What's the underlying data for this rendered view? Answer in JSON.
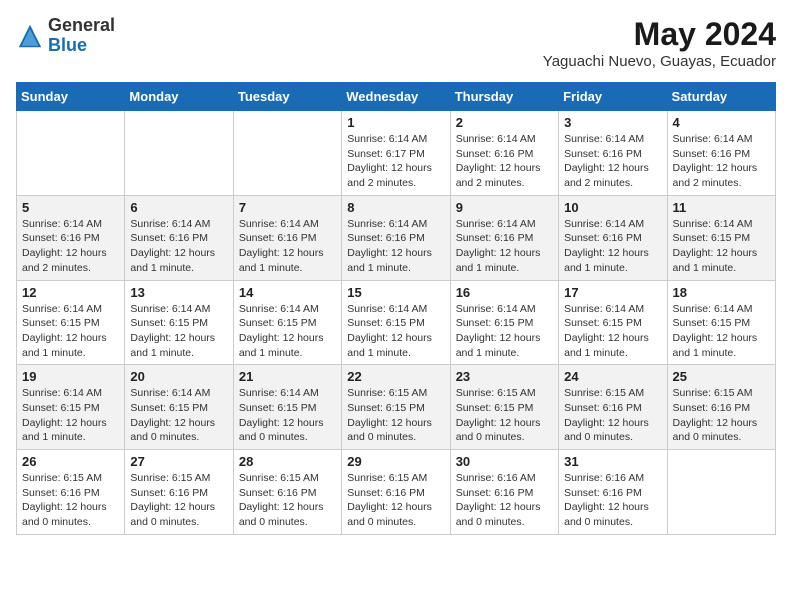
{
  "header": {
    "logo_general": "General",
    "logo_blue": "Blue",
    "month_title": "May 2024",
    "location": "Yaguachi Nuevo, Guayas, Ecuador"
  },
  "days_of_week": [
    "Sunday",
    "Monday",
    "Tuesday",
    "Wednesday",
    "Thursday",
    "Friday",
    "Saturday"
  ],
  "weeks": [
    [
      {
        "day": "",
        "info": ""
      },
      {
        "day": "",
        "info": ""
      },
      {
        "day": "",
        "info": ""
      },
      {
        "day": "1",
        "info": "Sunrise: 6:14 AM\nSunset: 6:17 PM\nDaylight: 12 hours and 2 minutes."
      },
      {
        "day": "2",
        "info": "Sunrise: 6:14 AM\nSunset: 6:16 PM\nDaylight: 12 hours and 2 minutes."
      },
      {
        "day": "3",
        "info": "Sunrise: 6:14 AM\nSunset: 6:16 PM\nDaylight: 12 hours and 2 minutes."
      },
      {
        "day": "4",
        "info": "Sunrise: 6:14 AM\nSunset: 6:16 PM\nDaylight: 12 hours and 2 minutes."
      }
    ],
    [
      {
        "day": "5",
        "info": "Sunrise: 6:14 AM\nSunset: 6:16 PM\nDaylight: 12 hours and 2 minutes."
      },
      {
        "day": "6",
        "info": "Sunrise: 6:14 AM\nSunset: 6:16 PM\nDaylight: 12 hours and 1 minute."
      },
      {
        "day": "7",
        "info": "Sunrise: 6:14 AM\nSunset: 6:16 PM\nDaylight: 12 hours and 1 minute."
      },
      {
        "day": "8",
        "info": "Sunrise: 6:14 AM\nSunset: 6:16 PM\nDaylight: 12 hours and 1 minute."
      },
      {
        "day": "9",
        "info": "Sunrise: 6:14 AM\nSunset: 6:16 PM\nDaylight: 12 hours and 1 minute."
      },
      {
        "day": "10",
        "info": "Sunrise: 6:14 AM\nSunset: 6:16 PM\nDaylight: 12 hours and 1 minute."
      },
      {
        "day": "11",
        "info": "Sunrise: 6:14 AM\nSunset: 6:15 PM\nDaylight: 12 hours and 1 minute."
      }
    ],
    [
      {
        "day": "12",
        "info": "Sunrise: 6:14 AM\nSunset: 6:15 PM\nDaylight: 12 hours and 1 minute."
      },
      {
        "day": "13",
        "info": "Sunrise: 6:14 AM\nSunset: 6:15 PM\nDaylight: 12 hours and 1 minute."
      },
      {
        "day": "14",
        "info": "Sunrise: 6:14 AM\nSunset: 6:15 PM\nDaylight: 12 hours and 1 minute."
      },
      {
        "day": "15",
        "info": "Sunrise: 6:14 AM\nSunset: 6:15 PM\nDaylight: 12 hours and 1 minute."
      },
      {
        "day": "16",
        "info": "Sunrise: 6:14 AM\nSunset: 6:15 PM\nDaylight: 12 hours and 1 minute."
      },
      {
        "day": "17",
        "info": "Sunrise: 6:14 AM\nSunset: 6:15 PM\nDaylight: 12 hours and 1 minute."
      },
      {
        "day": "18",
        "info": "Sunrise: 6:14 AM\nSunset: 6:15 PM\nDaylight: 12 hours and 1 minute."
      }
    ],
    [
      {
        "day": "19",
        "info": "Sunrise: 6:14 AM\nSunset: 6:15 PM\nDaylight: 12 hours and 1 minute."
      },
      {
        "day": "20",
        "info": "Sunrise: 6:14 AM\nSunset: 6:15 PM\nDaylight: 12 hours and 0 minutes."
      },
      {
        "day": "21",
        "info": "Sunrise: 6:14 AM\nSunset: 6:15 PM\nDaylight: 12 hours and 0 minutes."
      },
      {
        "day": "22",
        "info": "Sunrise: 6:15 AM\nSunset: 6:15 PM\nDaylight: 12 hours and 0 minutes."
      },
      {
        "day": "23",
        "info": "Sunrise: 6:15 AM\nSunset: 6:15 PM\nDaylight: 12 hours and 0 minutes."
      },
      {
        "day": "24",
        "info": "Sunrise: 6:15 AM\nSunset: 6:16 PM\nDaylight: 12 hours and 0 minutes."
      },
      {
        "day": "25",
        "info": "Sunrise: 6:15 AM\nSunset: 6:16 PM\nDaylight: 12 hours and 0 minutes."
      }
    ],
    [
      {
        "day": "26",
        "info": "Sunrise: 6:15 AM\nSunset: 6:16 PM\nDaylight: 12 hours and 0 minutes."
      },
      {
        "day": "27",
        "info": "Sunrise: 6:15 AM\nSunset: 6:16 PM\nDaylight: 12 hours and 0 minutes."
      },
      {
        "day": "28",
        "info": "Sunrise: 6:15 AM\nSunset: 6:16 PM\nDaylight: 12 hours and 0 minutes."
      },
      {
        "day": "29",
        "info": "Sunrise: 6:15 AM\nSunset: 6:16 PM\nDaylight: 12 hours and 0 minutes."
      },
      {
        "day": "30",
        "info": "Sunrise: 6:16 AM\nSunset: 6:16 PM\nDaylight: 12 hours and 0 minutes."
      },
      {
        "day": "31",
        "info": "Sunrise: 6:16 AM\nSunset: 6:16 PM\nDaylight: 12 hours and 0 minutes."
      },
      {
        "day": "",
        "info": ""
      }
    ]
  ]
}
